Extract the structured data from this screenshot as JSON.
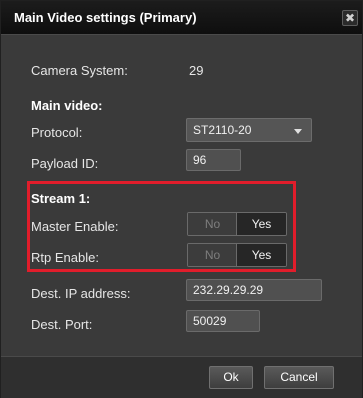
{
  "window": {
    "title": "Main Video settings (Primary)",
    "close_glyph": "✖"
  },
  "camera_system": {
    "label": "Camera System:",
    "value": "29"
  },
  "main_video": {
    "heading": "Main video:",
    "protocol_label": "Protocol:",
    "protocol_value": "ST2110-20",
    "payload_label": "Payload ID:",
    "payload_value": "96"
  },
  "stream1": {
    "heading": "Stream 1:",
    "master_label": "Master Enable:",
    "rtp_label": "Rtp Enable:",
    "toggle_no": "No",
    "toggle_yes": "Yes",
    "master_selected": "Yes",
    "rtp_selected": "Yes"
  },
  "destination": {
    "ip_label": "Dest. IP address:",
    "ip_value": "232.29.29.29",
    "port_label": "Dest. Port:",
    "port_value": "50029"
  },
  "buttons": {
    "ok": "Ok",
    "cancel": "Cancel"
  },
  "colors": {
    "highlight": "#e11d2b"
  }
}
